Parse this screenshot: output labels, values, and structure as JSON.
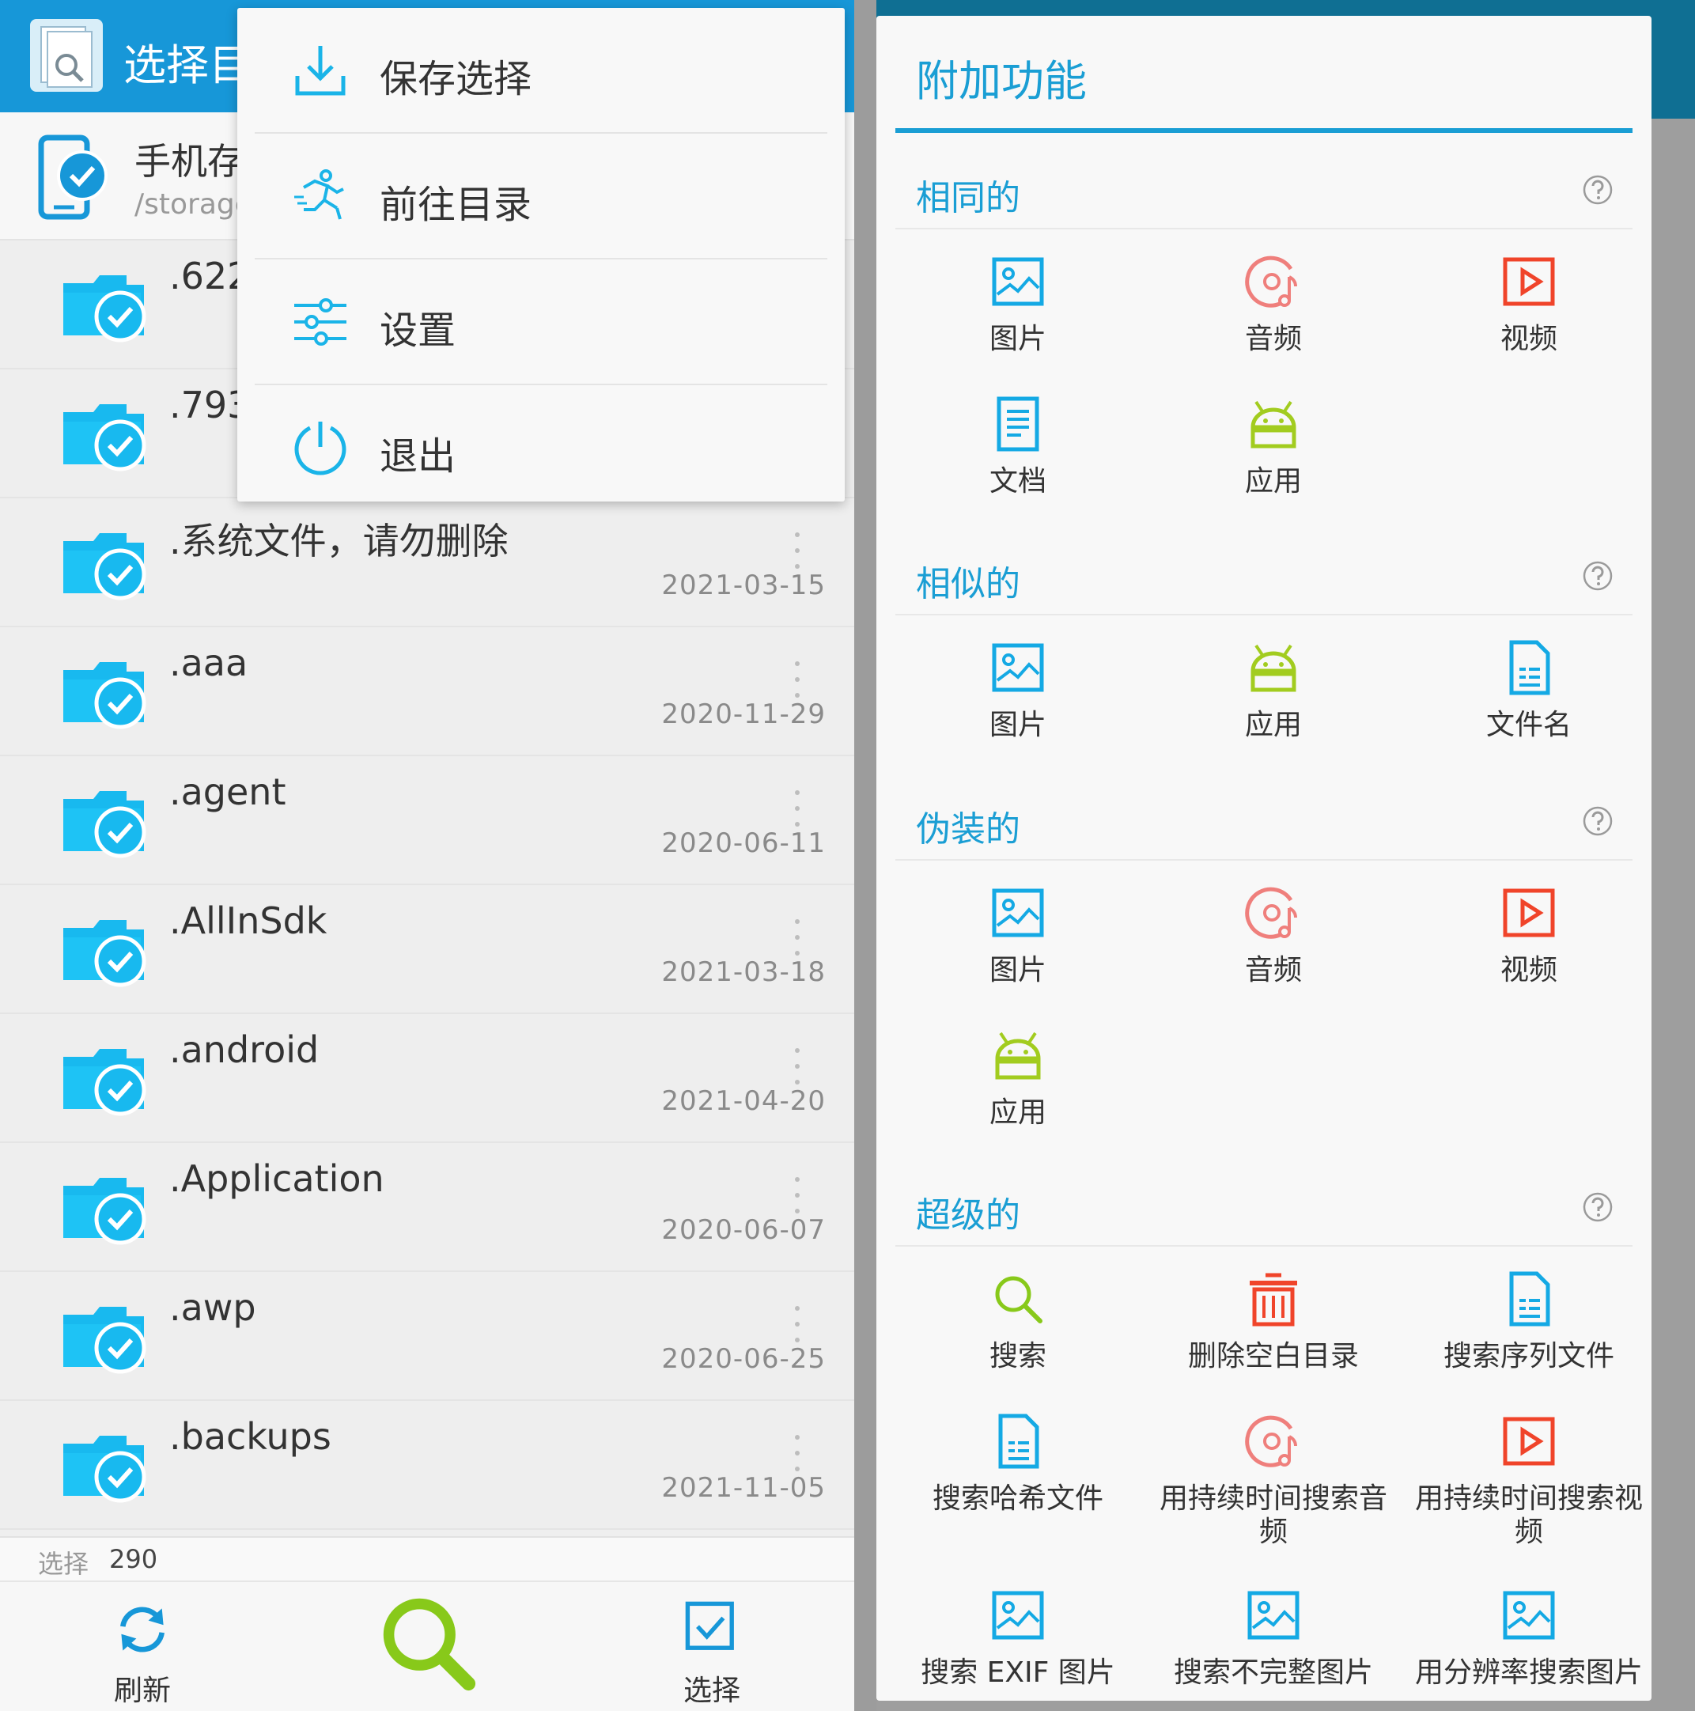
{
  "left": {
    "app_title": "选择目",
    "storage": {
      "name": "手机存",
      "path": "/storage"
    },
    "items": [
      {
        "name": ".622",
        "date": ""
      },
      {
        "name": ".793",
        "date": ""
      },
      {
        "name": ".系统文件，请勿删除",
        "date": "2021-03-15"
      },
      {
        "name": ".aaa",
        "date": "2020-11-29"
      },
      {
        "name": ".agent",
        "date": "2020-06-11"
      },
      {
        "name": ".AllInSdk",
        "date": "2021-03-18"
      },
      {
        "name": ".android",
        "date": "2021-04-20"
      },
      {
        "name": ".Application",
        "date": "2020-06-07"
      },
      {
        "name": ".awp",
        "date": "2020-06-25"
      },
      {
        "name": ".backups",
        "date": "2021-11-05"
      }
    ],
    "selection": {
      "label": "选择",
      "count": "290"
    },
    "bottom": {
      "refresh": "刷新",
      "select": "选择"
    }
  },
  "menu": {
    "items": [
      {
        "label": "保存选择",
        "icon": "download-icon"
      },
      {
        "label": "前往目录",
        "icon": "running-man-icon"
      },
      {
        "label": "设置",
        "icon": "sliders-icon"
      },
      {
        "label": "退出",
        "icon": "power-icon"
      }
    ]
  },
  "dialog": {
    "title": "附加功能",
    "sections": [
      {
        "title": "相同的",
        "items": [
          "图片",
          "音频",
          "视频",
          "文档",
          "应用"
        ]
      },
      {
        "title": "相似的",
        "items": [
          "图片",
          "应用",
          "文件名"
        ]
      },
      {
        "title": "伪装的",
        "items": [
          "图片",
          "音频",
          "视频",
          "应用"
        ]
      },
      {
        "title": "超级的",
        "items": [
          "搜索",
          "删除空白目录",
          "搜索序列文件",
          "搜索哈希文件",
          "用持续时间搜索音频",
          "用持续时间搜索视频",
          "搜索 EXIF 图片",
          "搜索不完整图片",
          "用分辨率搜索图片"
        ]
      }
    ]
  },
  "colors": {
    "primary": "#1797d8",
    "accent_blue": "#1a9ed4",
    "folder": "#18b9ef",
    "image_icon": "#14a9e4",
    "audio_icon": "#ef7f7c",
    "video_icon": "#f0442a",
    "android_icon": "#a2cc1f",
    "search_green": "#88c91a"
  }
}
